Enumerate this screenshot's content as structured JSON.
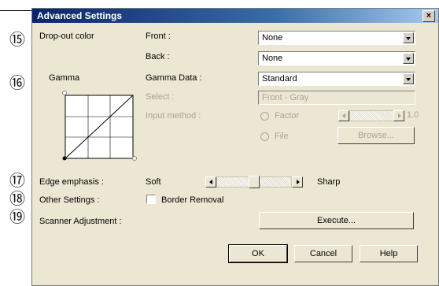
{
  "dialog": {
    "title": "Advanced Settings",
    "close_label": "×"
  },
  "callouts": [
    "⑮",
    "⑯",
    "⑰",
    "⑱",
    "⑲"
  ],
  "dropout": {
    "label": "Drop-out color",
    "front_label": "Front :",
    "front_value": "None",
    "back_label": "Back :",
    "back_value": "None"
  },
  "gamma": {
    "label": "Gamma",
    "data_label": "Gamma Data :",
    "data_value": "Standard",
    "select_label": "Select :",
    "select_value": "Front - Gray",
    "input_label": "Input method :",
    "factor_label": "Factor",
    "factor_value": "1.0",
    "file_label": "File",
    "browse_label": "Browse..."
  },
  "edge": {
    "label": "Edge emphasis :",
    "soft": "Soft",
    "sharp": "Sharp",
    "level": 0.5
  },
  "other": {
    "label": "Other Settings :",
    "border_removal": "Border Removal",
    "border_removal_checked": false
  },
  "scanner": {
    "label": "Scanner Adjustment :",
    "execute": "Execute..."
  },
  "footer": {
    "ok": "OK",
    "cancel": "Cancel",
    "help": "Help"
  }
}
